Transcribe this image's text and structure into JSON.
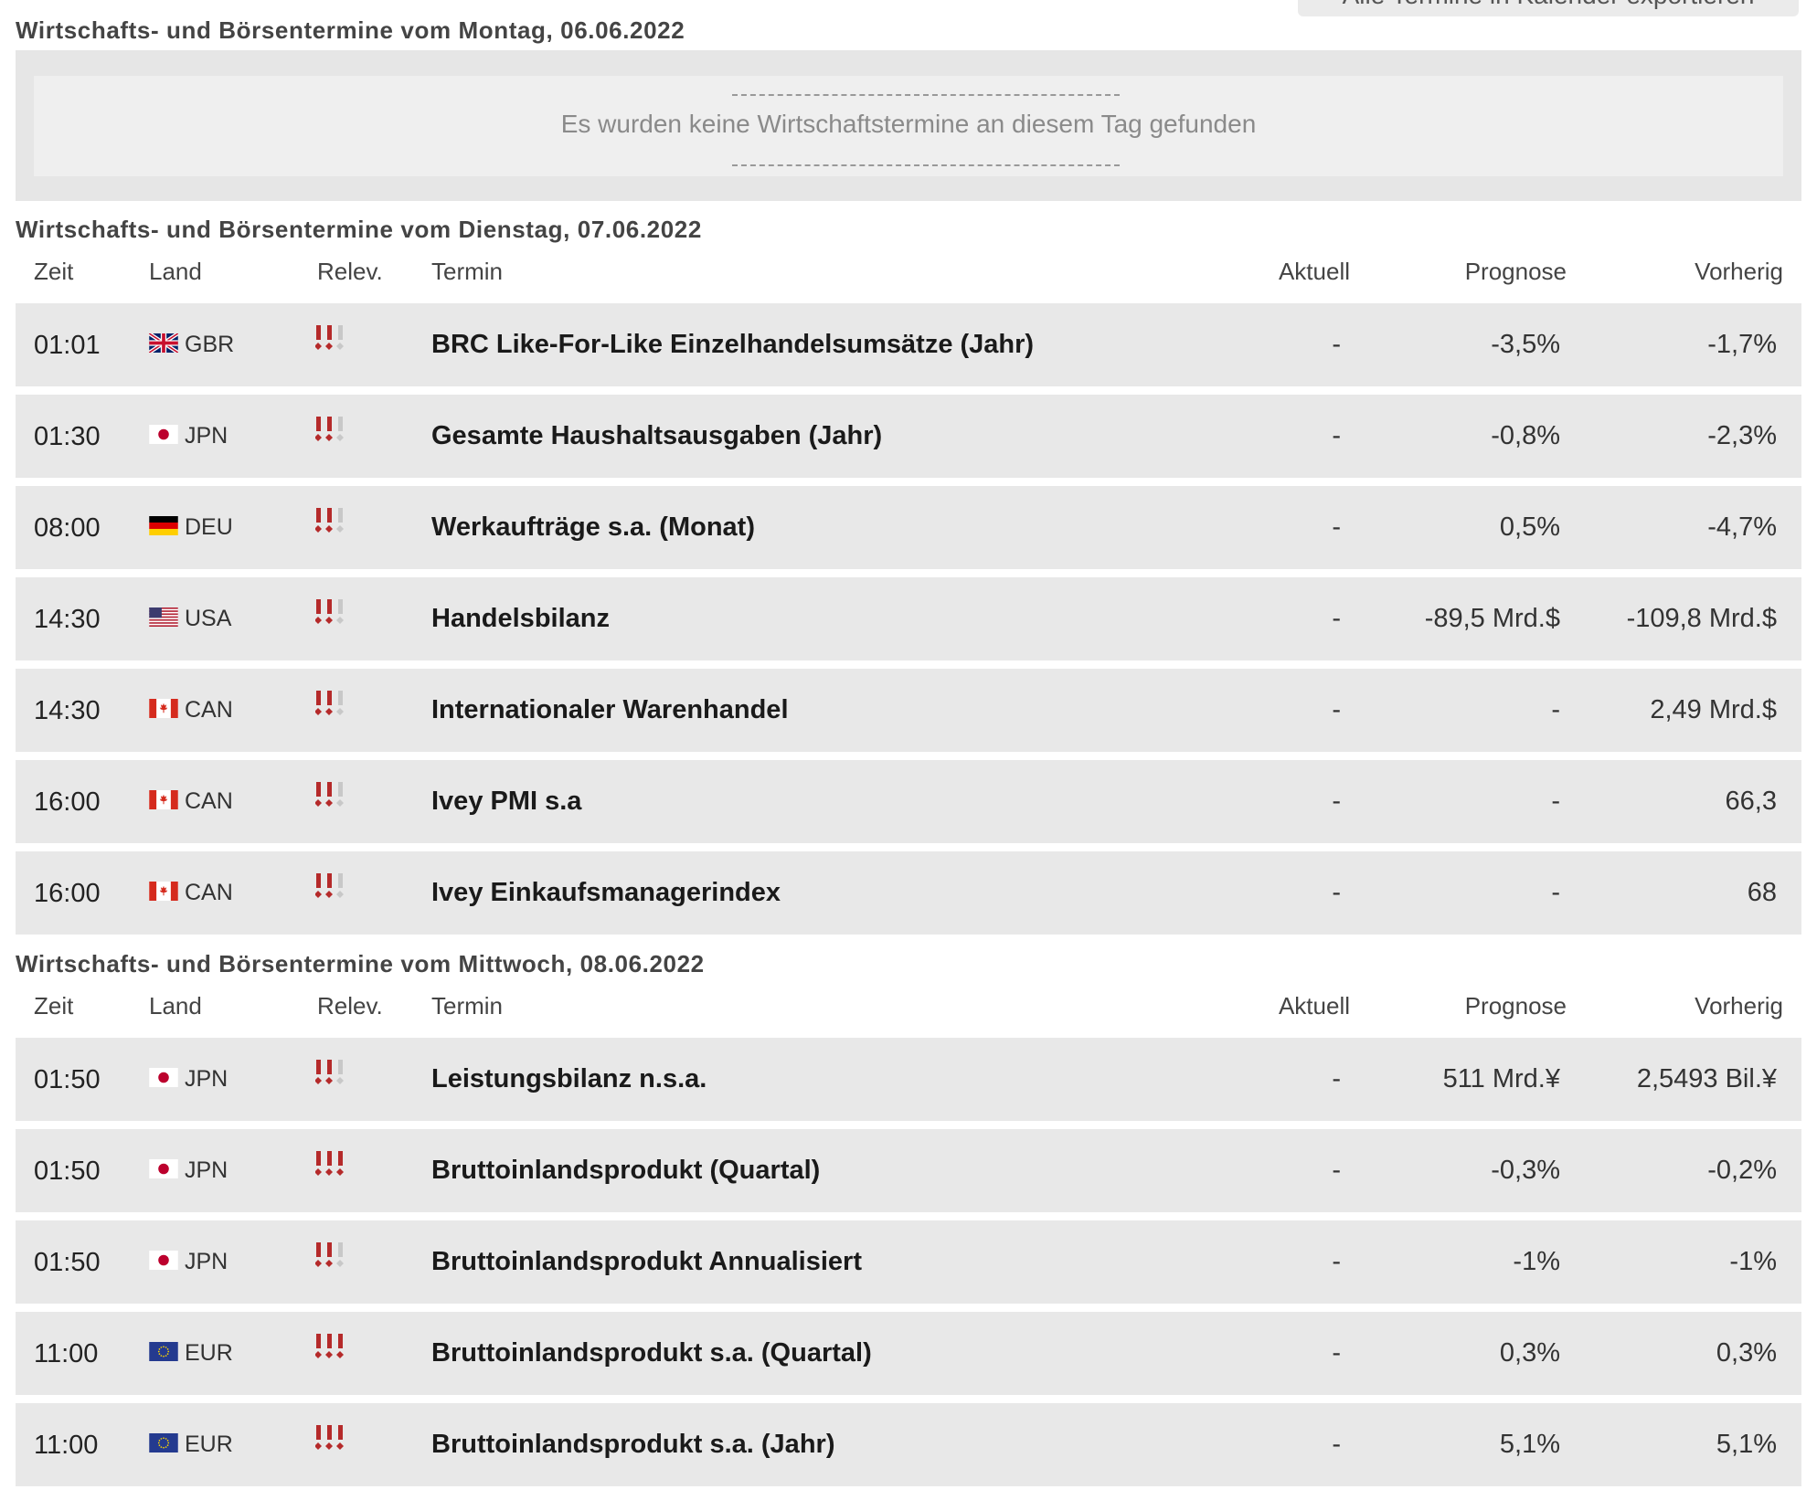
{
  "export_label": "Alle Termine in Kalender exportieren",
  "columns": {
    "time": "Zeit",
    "country": "Land",
    "relevance": "Relev.",
    "event": "Termin",
    "actual": "Aktuell",
    "forecast": "Prognose",
    "previous": "Vorherig"
  },
  "days": [
    {
      "title": "Wirtschafts- und Börsentermine vom Montag, 06.06.2022",
      "empty_text": "Es wurden keine Wirtschaftstermine an diesem Tag gefunden",
      "rows": []
    },
    {
      "title": "Wirtschafts- und Börsentermine vom Dienstag, 07.06.2022",
      "rows": [
        {
          "time": "01:01",
          "flag": "gb-flag-icon",
          "country": "GBR",
          "relevance": 2,
          "event": "BRC Like-For-Like Einzelhandelsumsätze (Jahr)",
          "actual": "-",
          "forecast": "-3,5%",
          "previous": "-1,7%"
        },
        {
          "time": "01:30",
          "flag": "jp-flag-icon",
          "country": "JPN",
          "relevance": 2,
          "event": "Gesamte Haushaltsausgaben (Jahr)",
          "actual": "-",
          "forecast": "-0,8%",
          "previous": "-2,3%"
        },
        {
          "time": "08:00",
          "flag": "de-flag-icon",
          "country": "DEU",
          "relevance": 2,
          "event": "Werkaufträge s.a. (Monat)",
          "actual": "-",
          "forecast": "0,5%",
          "previous": "-4,7%"
        },
        {
          "time": "14:30",
          "flag": "us-flag-icon",
          "country": "USA",
          "relevance": 2,
          "event": "Handelsbilanz",
          "actual": "-",
          "forecast": "-89,5 Mrd.$",
          "previous": "-109,8 Mrd.$"
        },
        {
          "time": "14:30",
          "flag": "ca-flag-icon",
          "country": "CAN",
          "relevance": 2,
          "event": "Internationaler Warenhandel",
          "actual": "-",
          "forecast": "-",
          "previous": "2,49 Mrd.$"
        },
        {
          "time": "16:00",
          "flag": "ca-flag-icon",
          "country": "CAN",
          "relevance": 2,
          "event": "Ivey PMI s.a",
          "actual": "-",
          "forecast": "-",
          "previous": "66,3"
        },
        {
          "time": "16:00",
          "flag": "ca-flag-icon",
          "country": "CAN",
          "relevance": 2,
          "event": "Ivey Einkaufsmanagerindex",
          "actual": "-",
          "forecast": "-",
          "previous": "68"
        }
      ]
    },
    {
      "title": "Wirtschafts- und Börsentermine vom Mittwoch, 08.06.2022",
      "rows": [
        {
          "time": "01:50",
          "flag": "jp-flag-icon",
          "country": "JPN",
          "relevance": 2,
          "event": "Leistungsbilanz n.s.a.",
          "actual": "-",
          "forecast": "511 Mrd.¥",
          "previous": "2,5493 Bil.¥"
        },
        {
          "time": "01:50",
          "flag": "jp-flag-icon",
          "country": "JPN",
          "relevance": 3,
          "event": "Bruttoinlandsprodukt (Quartal)",
          "actual": "-",
          "forecast": "-0,3%",
          "previous": "-0,2%"
        },
        {
          "time": "01:50",
          "flag": "jp-flag-icon",
          "country": "JPN",
          "relevance": 2,
          "event": "Bruttoinlandsprodukt Annualisiert",
          "actual": "-",
          "forecast": "-1%",
          "previous": "-1%"
        },
        {
          "time": "11:00",
          "flag": "eu-flag-icon",
          "country": "EUR",
          "relevance": 3,
          "event": "Bruttoinlandsprodukt s.a. (Quartal)",
          "actual": "-",
          "forecast": "0,3%",
          "previous": "0,3%"
        },
        {
          "time": "11:00",
          "flag": "eu-flag-icon",
          "country": "EUR",
          "relevance": 3,
          "event": "Bruttoinlandsprodukt s.a. (Jahr)",
          "actual": "-",
          "forecast": "5,1%",
          "previous": "5,1%"
        }
      ]
    }
  ],
  "colors": {
    "relevance_active": "#b52a2a",
    "relevance_inactive": "#c8c8c8"
  }
}
